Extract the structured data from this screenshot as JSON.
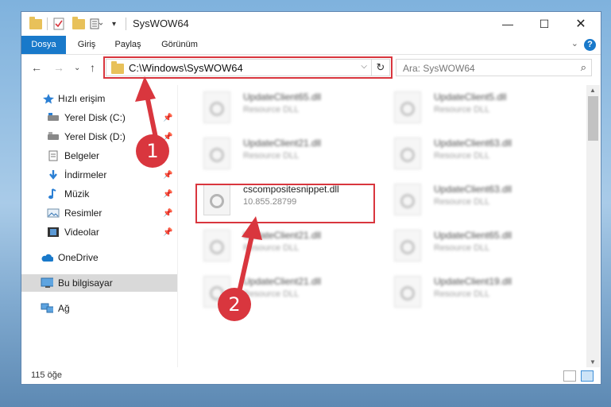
{
  "window": {
    "title": "SysWOW64"
  },
  "ribbon": {
    "tabs": [
      "Dosya",
      "Giriş",
      "Paylaş",
      "Görünüm"
    ],
    "help": "?"
  },
  "address": {
    "path": "C:\\Windows\\SysWOW64"
  },
  "search": {
    "placeholder": "Ara: SysWOW64"
  },
  "nav": {
    "items": [
      {
        "label": "Hızlı erişim",
        "icon": "star-icon"
      },
      {
        "label": "Yerel Disk (C:)",
        "icon": "drive-icon"
      },
      {
        "label": "Yerel Disk (D:)",
        "icon": "drive-icon"
      },
      {
        "label": "Belgeler",
        "icon": "documents-icon"
      },
      {
        "label": "İndirmeler",
        "icon": "download-icon"
      },
      {
        "label": "Müzik",
        "icon": "music-icon"
      },
      {
        "label": "Resimler",
        "icon": "pictures-icon"
      },
      {
        "label": "Videolar",
        "icon": "video-icon"
      },
      {
        "label": "OneDrive",
        "icon": "cloud-icon"
      },
      {
        "label": "Bu bilgisayar",
        "icon": "computer-icon"
      },
      {
        "label": "Ağ",
        "icon": "network-icon"
      }
    ]
  },
  "files": [
    {
      "name": "UpdateClient65.dll",
      "desc": "Resource DLL"
    },
    {
      "name": "UpdateClient5.dll",
      "desc": "Resource DLL"
    },
    {
      "name": "UpdateClient21.dll",
      "desc": "Resource DLL"
    },
    {
      "name": "UpdateClient63.dll",
      "desc": "Resource DLL"
    },
    {
      "name": "cscompositesnippet.dll",
      "desc": "10.855.28799"
    },
    {
      "name": "UpdateClient63.dll",
      "desc": "Resource DLL"
    },
    {
      "name": "UpdateClient21.dll",
      "desc": "Resource DLL"
    },
    {
      "name": "UpdateClient65.dll",
      "desc": "Resource DLL"
    },
    {
      "name": "UpdateClient21.dll",
      "desc": "Resource DLL"
    },
    {
      "name": "UpdateClient19.dll",
      "desc": "Resource DLL"
    }
  ],
  "status": {
    "count": "115 öğe"
  },
  "callouts": {
    "one": "1",
    "two": "2"
  },
  "colors": {
    "accent": "#1979ca",
    "highlight": "#d9363e"
  }
}
